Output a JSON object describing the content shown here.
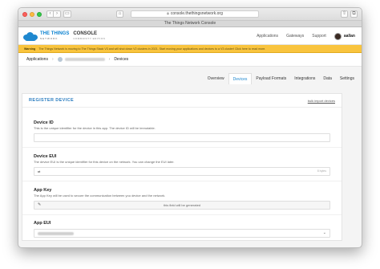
{
  "browser": {
    "url": "console.thethingsnetwork.org",
    "tab_title": "The Things Network Console"
  },
  "header": {
    "logo_line1": "THE THINGS",
    "logo_line2": "NETWORK",
    "console_label": "CONSOLE",
    "console_sub": "COMMUNITY EDITION",
    "nav": [
      "Applications",
      "Gateways",
      "Support"
    ],
    "username": "aallan"
  },
  "warning": {
    "label": "Warning",
    "text": "The Things Network is moving to The Things Stack V3 and will shut down V2 clusters in 2021. Start moving your applications and devices to a V3 cluster! Click here to read more."
  },
  "breadcrumb": {
    "first": "Applications",
    "last": "Devices"
  },
  "tabs": [
    {
      "label": "Overview",
      "active": false
    },
    {
      "label": "Devices",
      "active": true
    },
    {
      "label": "Payload Formats",
      "active": false
    },
    {
      "label": "Integrations",
      "active": false
    },
    {
      "label": "Data",
      "active": false
    },
    {
      "label": "Settings",
      "active": false
    }
  ],
  "card": {
    "title": "REGISTER DEVICE",
    "bulk_link": "bulk import devices"
  },
  "fields": {
    "device_id": {
      "label": "Device ID",
      "description": "This is the unique identifier for the device in this app. The device ID will be immutable."
    },
    "device_eui": {
      "label": "Device EUI",
      "description": "The device EUI is the unique identifier for this device on the network. You can change the EUI later.",
      "prefix": "⇄",
      "suffix": "8 bytes"
    },
    "app_key": {
      "label": "App Key",
      "description": "The App Key will be used to secure the communication between you device and the network.",
      "value": "this field will be generated"
    },
    "app_eui": {
      "label": "App EUI"
    }
  }
}
